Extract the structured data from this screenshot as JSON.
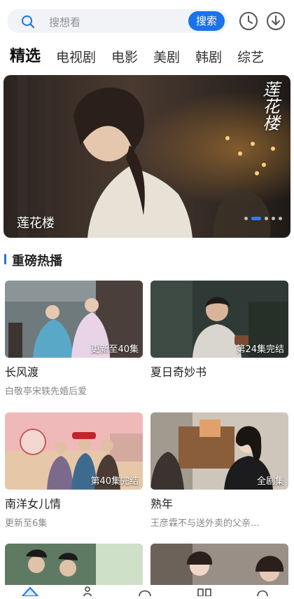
{
  "search": {
    "placeholder": "搜想看",
    "button": "搜索"
  },
  "header_icons": [
    "history-icon",
    "download-icon"
  ],
  "tabs": [
    "精选",
    "电视剧",
    "电影",
    "美剧",
    "韩剧",
    "综艺"
  ],
  "banner": {
    "title": "莲花楼",
    "poster_text": "莲花楼",
    "page_index": 2,
    "page_count": 5
  },
  "section": {
    "title": "重磅热播"
  },
  "cards": [
    {
      "title": "长风渡",
      "badge": "更新至40集",
      "subtitle": "白敬亭宋轶先婚后爱"
    },
    {
      "title": "夏日奇妙书",
      "badge": "第24集完结",
      "subtitle": ""
    },
    {
      "title": "南洋女儿情",
      "badge": "第40集完结",
      "subtitle": "更新至6集"
    },
    {
      "title": "熟年",
      "badge": "全剧集",
      "subtitle": "王彦霖不与送外卖的父亲..."
    }
  ],
  "colors": {
    "accent": "#1a73e8",
    "text": "#222222",
    "muted": "#888888"
  }
}
